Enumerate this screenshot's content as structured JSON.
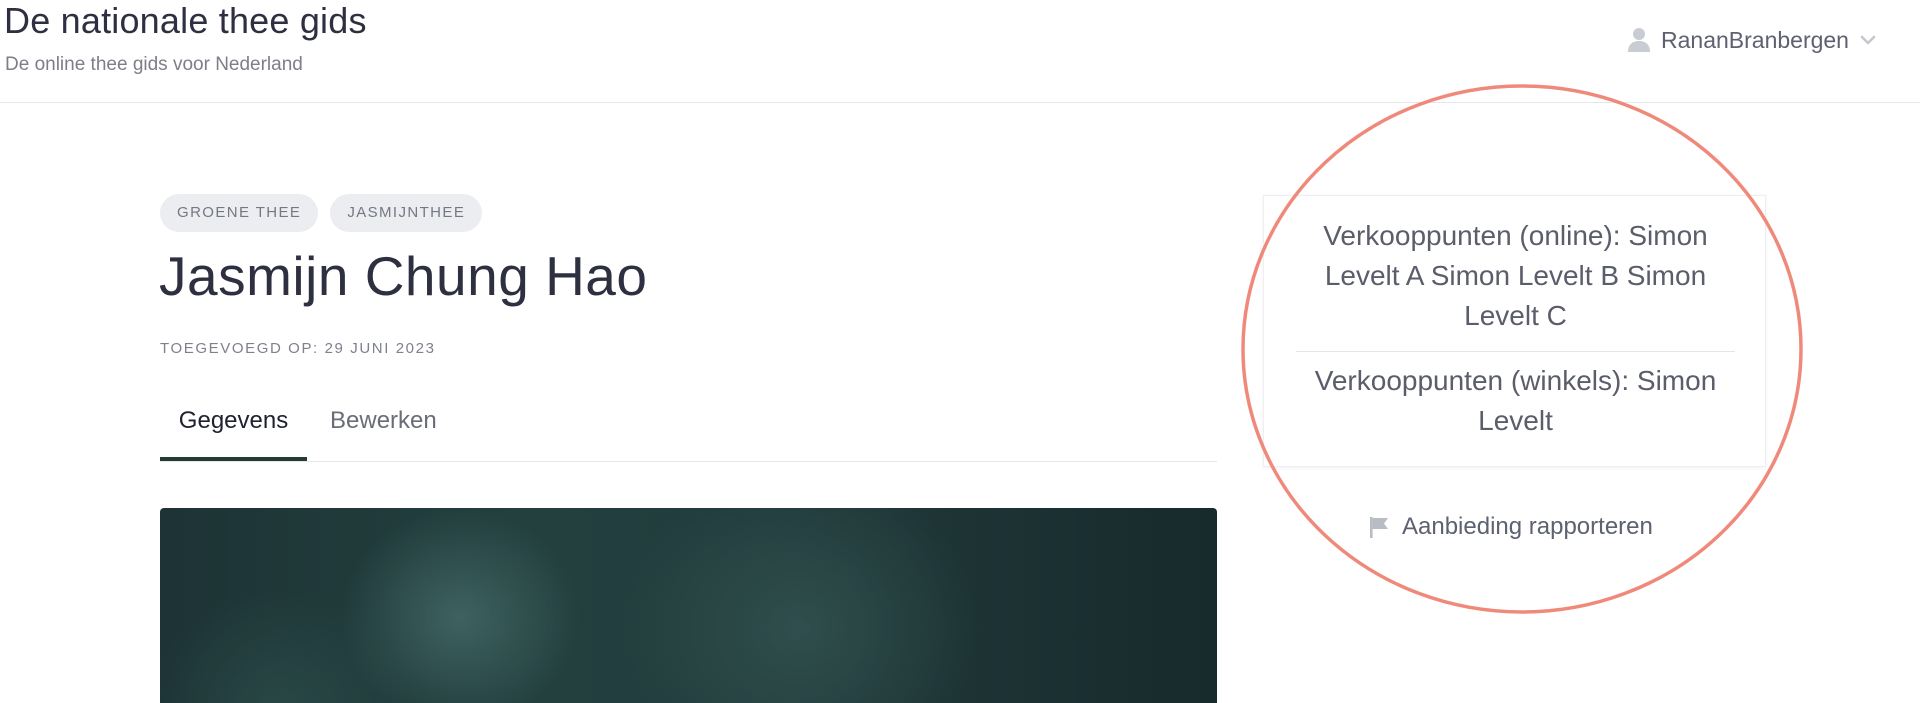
{
  "header": {
    "title": "De nationale thee gids",
    "subtitle": "De online thee gids voor Nederland",
    "user": {
      "name": "RananBranbergen",
      "icon": "user-icon",
      "dropdown_icon": "chevron-down-icon"
    }
  },
  "product": {
    "tags": [
      {
        "label": "GROENE THEE"
      },
      {
        "label": "JASMIJNTHEE"
      }
    ],
    "title": "Jasmijn Chung Hao",
    "added_date": "TOEGEVOEGD OP: 29 JUNI 2023",
    "tabs": [
      {
        "label": "Gegevens",
        "active": true
      },
      {
        "label": "Bewerken",
        "active": false
      }
    ]
  },
  "sidebar": {
    "online_outlets": "Verkooppunten (online): Simon Levelt A Simon Levelt B Simon Levelt C",
    "shop_outlets": "Verkooppunten (winkels): Simon Levelt",
    "report_link": "Aanbieding rapporteren",
    "report_icon": "flag-icon"
  },
  "colors": {
    "annotation_circle": "#ef8a7b",
    "active_tab_underline": "#243b34",
    "hero_background": "#1f3637"
  }
}
